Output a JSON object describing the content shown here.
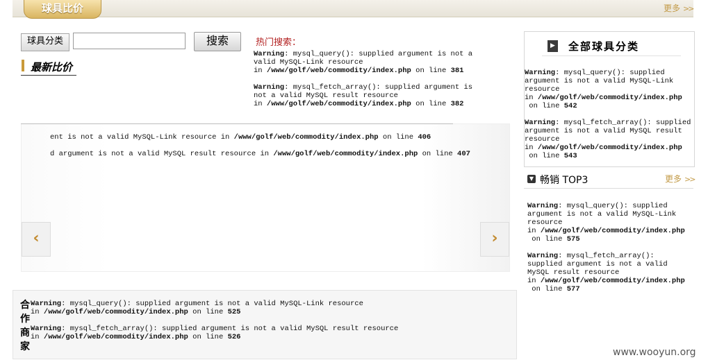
{
  "header": {
    "title": "球具比价",
    "more_label": "更多",
    "more_chevrons": ">>"
  },
  "search": {
    "category_button": "球具分类",
    "input_value": "",
    "search_button": "搜索",
    "hot_label": "热门搜索："
  },
  "latest": {
    "title": "最新比价"
  },
  "hot_warnings": [
    {
      "prefix": "Warning",
      "msg_lines": [
        ": mysql_query(): supplied argument is not a",
        "valid MySQL-Link resource"
      ],
      "path": "/www/golf/web/commodity/index.php",
      "line": "381"
    },
    {
      "prefix": "Warning",
      "msg_lines": [
        ": mysql_fetch_array(): supplied argument is",
        "not a valid MySQL result resource"
      ],
      "path": "/www/golf/web/commodity/index.php",
      "line": "382"
    }
  ],
  "carousel": {
    "lines": [
      {
        "text": "ent is not a valid MySQL-Link resource in ",
        "path": "/www/golf/web/commodity/index.php",
        "line": "406"
      },
      {
        "text": "d argument is not a valid MySQL result resource in ",
        "path": "/www/golf/web/commodity/index.php",
        "line": "407"
      }
    ],
    "prev_icon": "‹",
    "next_icon": "›"
  },
  "sidebar": {
    "categories_title": "全部球具分类",
    "categories_warnings": [
      {
        "prefix": "Warning",
        "msg_lines": [
          ": mysql_query(): supplied",
          "argument is not a valid MySQL-Link",
          "resource"
        ],
        "path": "/www/golf/web/commodity/index.php",
        "line": "542"
      },
      {
        "prefix": "Warning",
        "msg_lines": [
          ": mysql_fetch_array(): supplied",
          "argument is not a valid MySQL result",
          "resource"
        ],
        "path": "/www/golf/web/commodity/index.php",
        "line": "543"
      }
    ],
    "top3_title": "畅销 TOP3",
    "top3_more": "更多",
    "top3_warnings": [
      {
        "prefix": "Warning",
        "msg_lines": [
          ": mysql_query(): supplied",
          "argument is not a valid MySQL-Link",
          "resource"
        ],
        "path": "/www/golf/web/commodity/index.php",
        "line": "575"
      },
      {
        "prefix": "Warning",
        "msg_lines": [
          ": mysql_fetch_array():",
          "supplied argument is not a valid",
          "MySQL result resource"
        ],
        "path": "/www/golf/web/commodity/index.php",
        "line": "577"
      }
    ]
  },
  "partners": {
    "label": "合作商家",
    "warnings": [
      {
        "prefix": "Warning",
        "msg_lines": [
          ": mysql_query(): supplied argument is not a valid MySQL-Link resource"
        ],
        "path": "/www/golf/web/commodity/index.php",
        "line": "525"
      },
      {
        "prefix": "Warning",
        "msg_lines": [
          ": mysql_fetch_array(): supplied argument is not a valid MySQL result resource"
        ],
        "path": "/www/golf/web/commodity/index.php",
        "line": "526"
      }
    ]
  },
  "watermark": "www.wooyun.org",
  "common": {
    "in_word": "in ",
    "on_line": " on line "
  },
  "colors": {
    "accent_gold": "#c99a3a",
    "hot_red": "#b21f1f",
    "more_gold": "#c39b48"
  }
}
